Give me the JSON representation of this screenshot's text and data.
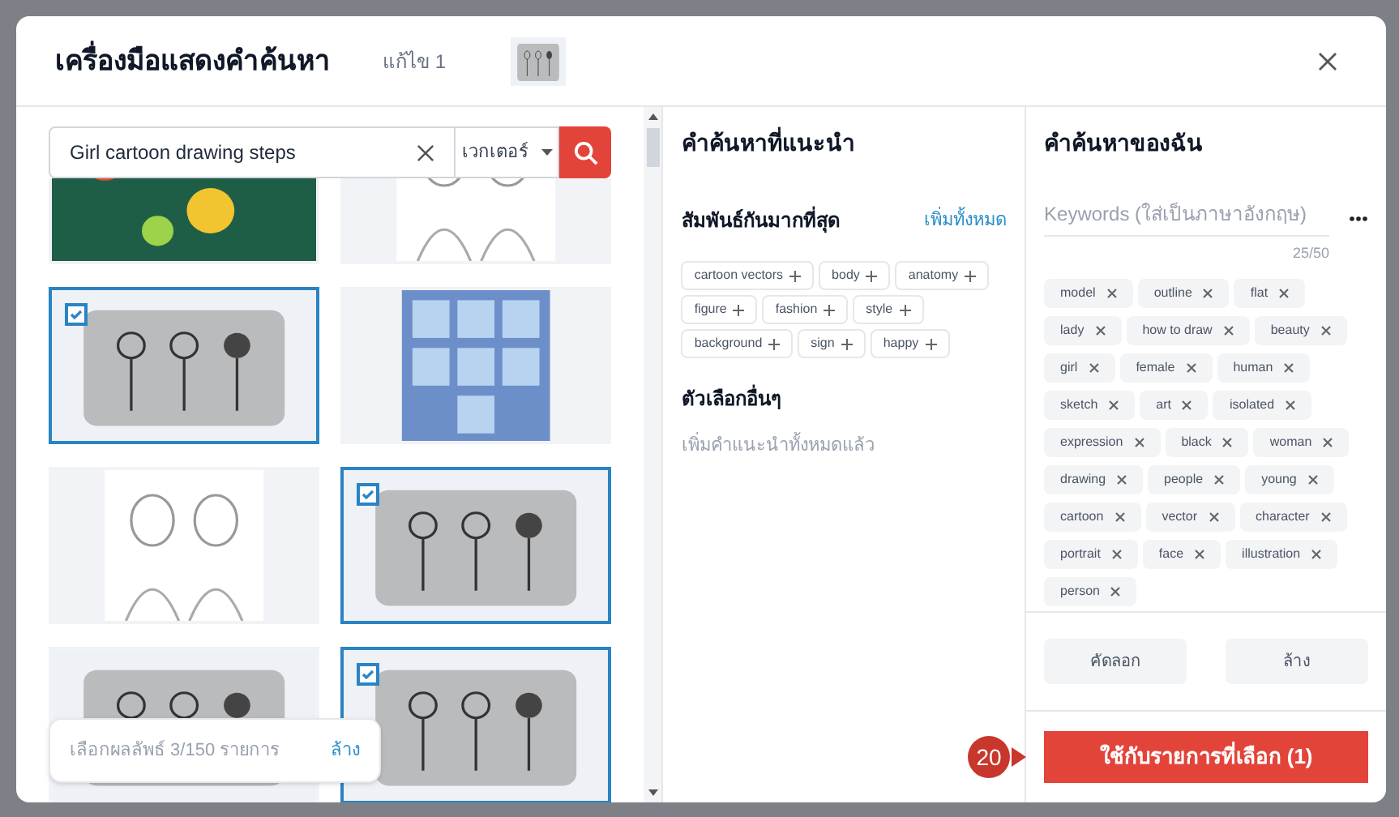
{
  "dialog": {
    "title": "เครื่องมือแสดงคำค้นหา",
    "revision": "แก้ไข 1",
    "thumbnail": {
      "kind": "picture"
    }
  },
  "search": {
    "value": "Girl cartoon drawing steps",
    "type": "เวกเตอร์"
  },
  "results": [
    {
      "kind": "picture",
      "selected": false
    },
    {
      "kind": "picture",
      "selected": false
    },
    {
      "kind": "picture",
      "selected": true
    },
    {
      "kind": "picture",
      "selected": false
    },
    {
      "kind": "picture",
      "selected": false
    },
    {
      "kind": "picture",
      "selected": true
    },
    {
      "kind": "picture",
      "selected": false
    },
    {
      "kind": "picture",
      "selected": true
    }
  ],
  "selection_bar": {
    "text": "เลือกผลลัพธ์ 3/150 รายการ",
    "clear": "ล้าง"
  },
  "suggested": {
    "title": "คำค้นหาที่แนะนำ",
    "related_heading": "สัมพันธ์กันมากที่สุด",
    "add_all": "เพิ่มทั้งหมด",
    "tags": [
      "cartoon vectors",
      "body",
      "anatomy",
      "figure",
      "fashion",
      "style",
      "background",
      "sign",
      "happy"
    ],
    "other_heading": "ตัวเลือกอื่นๆ",
    "other_text": "เพิ่มคำแนะนำทั้งหมดแล้ว"
  },
  "my_keywords": {
    "title": "คำค้นหาของฉัน",
    "placeholder": "Keywords (ใส่เป็นภาษาอังกฤษ)",
    "counter": "25/50",
    "tags": [
      "model",
      "outline",
      "flat",
      "lady",
      "how to draw",
      "beauty",
      "girl",
      "female",
      "human",
      "sketch",
      "art",
      "isolated",
      "expression",
      "black",
      "woman",
      "drawing",
      "people",
      "young",
      "cartoon",
      "vector",
      "character",
      "portrait",
      "face",
      "illustration",
      "person"
    ],
    "copy": "คัดลอก",
    "clear": "ล้าง"
  },
  "apply": {
    "label": "ใช้กับรายการที่เลือก (1)",
    "step": "20"
  }
}
